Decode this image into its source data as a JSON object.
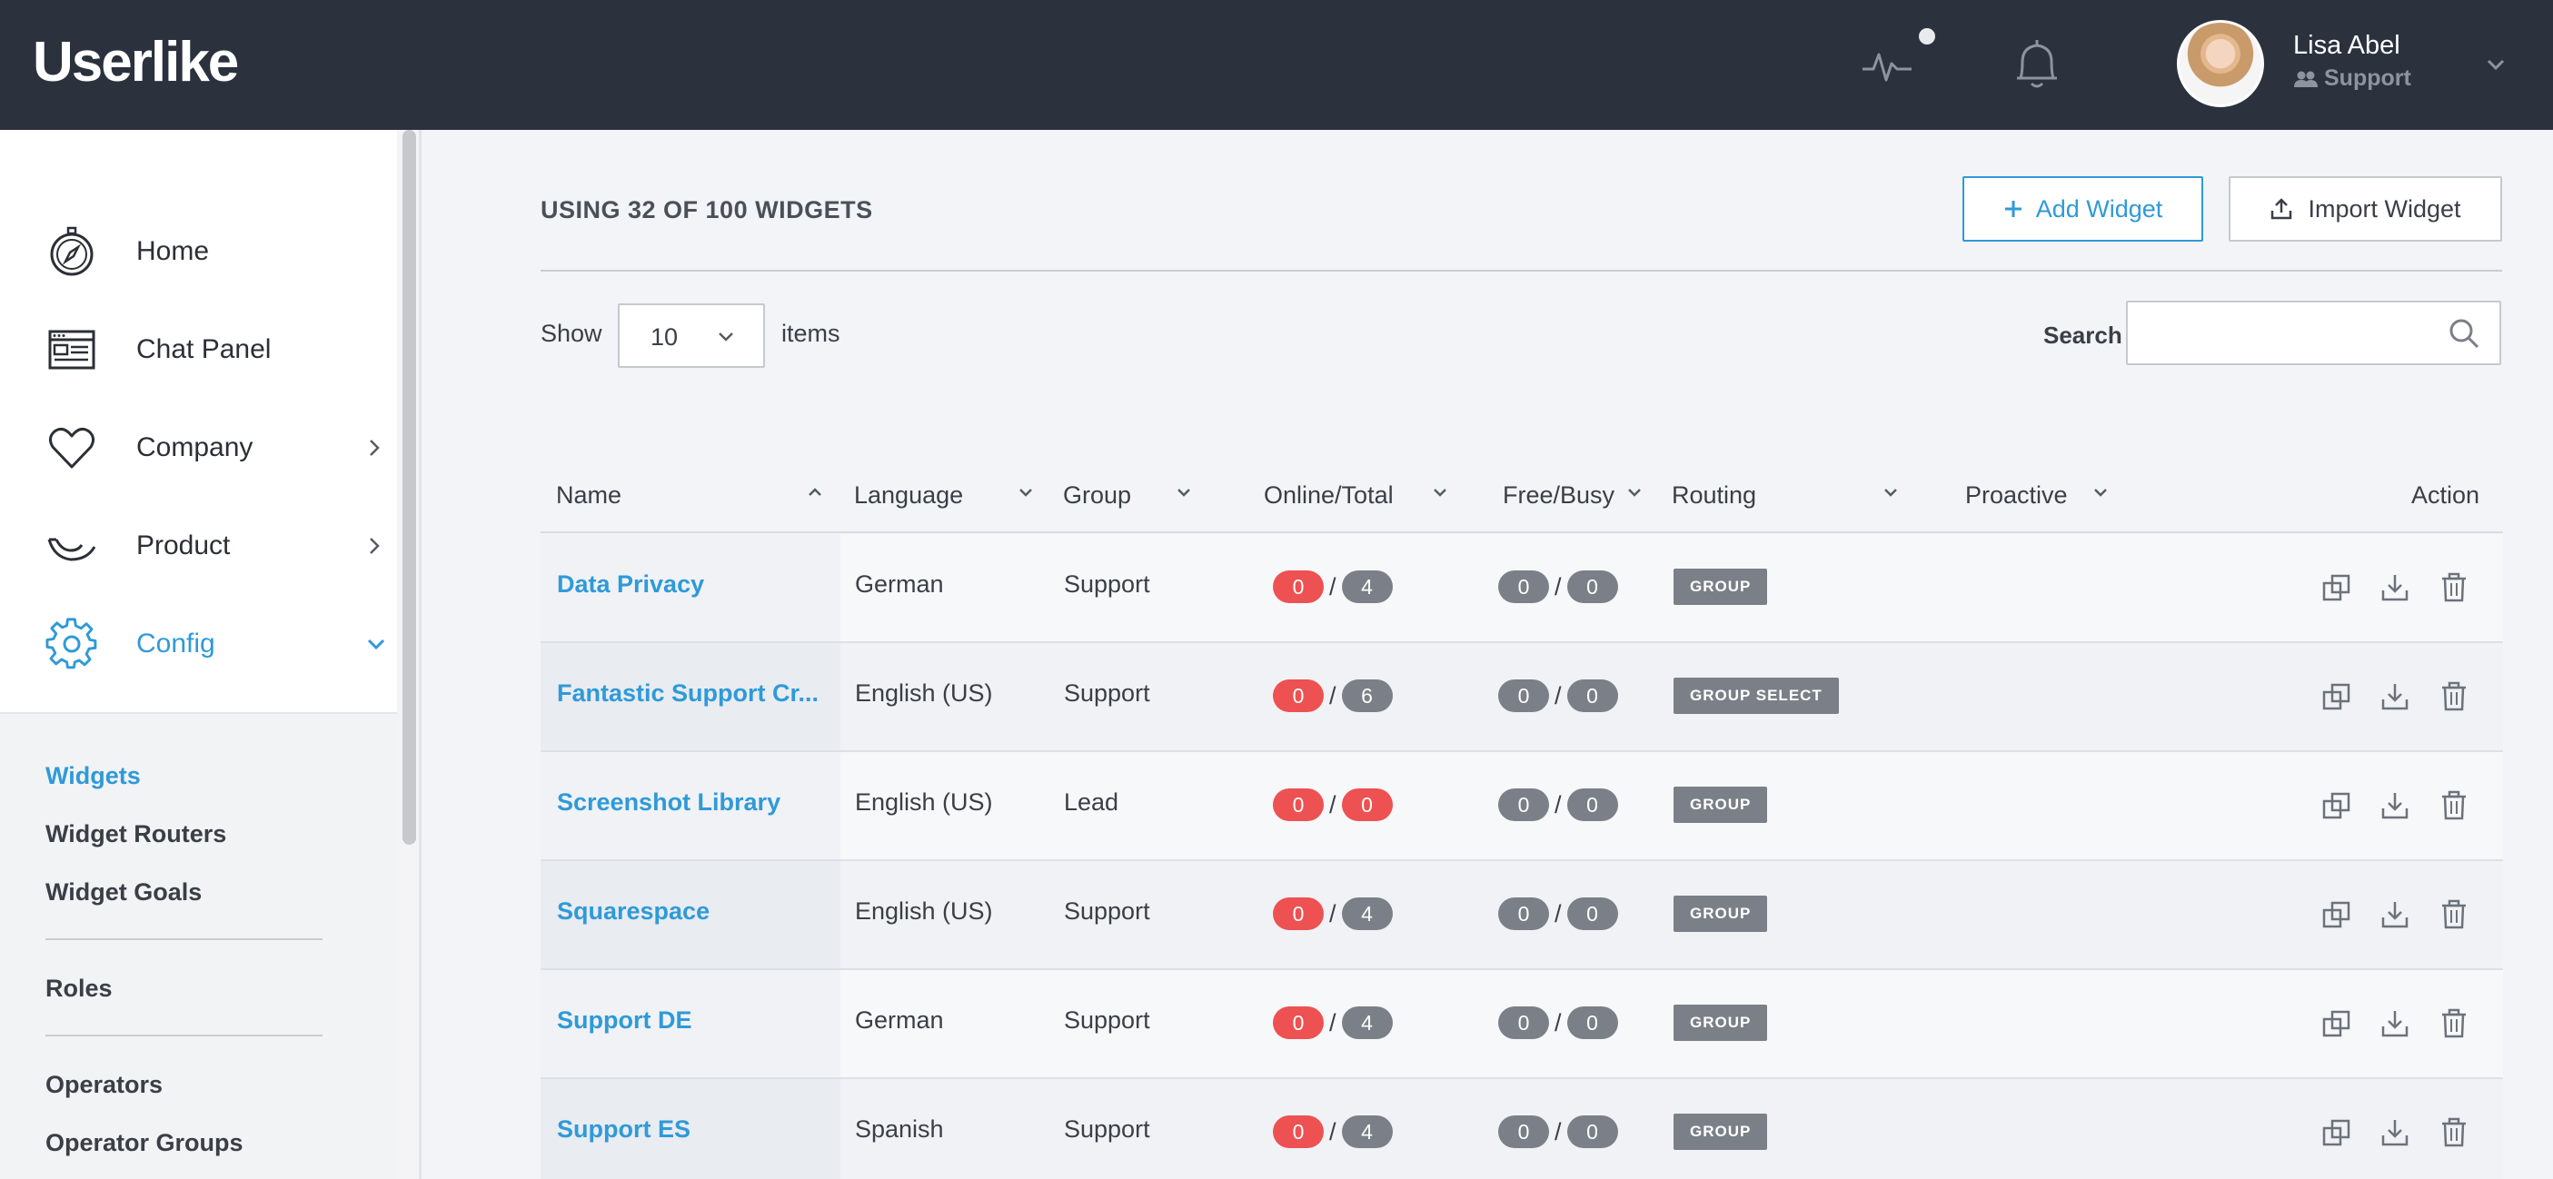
{
  "header": {
    "logo": "Userlike",
    "user": {
      "name": "Lisa Abel",
      "role": "Support"
    }
  },
  "sidebar": {
    "items": [
      {
        "label": "Home",
        "icon": "compass-icon"
      },
      {
        "label": "Chat Panel",
        "icon": "chat-panel-icon"
      },
      {
        "label": "Company",
        "icon": "heart-icon"
      },
      {
        "label": "Product",
        "icon": "product-icon"
      },
      {
        "label": "Config",
        "icon": "gear-icon"
      }
    ],
    "sub_items": {
      "widgets": "Widgets",
      "widget_routers": "Widget Routers",
      "widget_goals": "Widget Goals",
      "roles": "Roles",
      "operators": "Operators",
      "operator_groups": "Operator Groups"
    }
  },
  "main": {
    "usage_title": "USING 32 OF 100 WIDGETS",
    "add_button": "Add Widget",
    "import_button": "Import Widget",
    "show_label": "Show",
    "show_value": "10",
    "items_label": "items",
    "search_label": "Search",
    "search_value": ""
  },
  "table": {
    "headers": {
      "name": "Name",
      "language": "Language",
      "group": "Group",
      "online_total": "Online/Total",
      "free_busy": "Free/Busy",
      "routing": "Routing",
      "proactive": "Proactive",
      "action": "Action"
    },
    "rows": [
      {
        "name": "Data Privacy",
        "language": "German",
        "group": "Support",
        "online": "0",
        "total": "4",
        "free": "0",
        "busy": "0",
        "routing": "GROUP",
        "proactive": ""
      },
      {
        "name": "Fantastic Support Cr...",
        "language": "English (US)",
        "group": "Support",
        "online": "0",
        "total": "6",
        "free": "0",
        "busy": "0",
        "routing": "GROUP SELECT",
        "proactive": ""
      },
      {
        "name": "Screenshot Library",
        "language": "English (US)",
        "group": "Lead",
        "online": "0",
        "total": "0",
        "free": "0",
        "busy": "0",
        "routing": "GROUP",
        "proactive": ""
      },
      {
        "name": "Squarespace",
        "language": "English (US)",
        "group": "Support",
        "online": "0",
        "total": "4",
        "free": "0",
        "busy": "0",
        "routing": "GROUP",
        "proactive": ""
      },
      {
        "name": "Support DE",
        "language": "German",
        "group": "Support",
        "online": "0",
        "total": "4",
        "free": "0",
        "busy": "0",
        "routing": "GROUP",
        "proactive": ""
      },
      {
        "name": "Support ES",
        "language": "Spanish",
        "group": "Support",
        "online": "0",
        "total": "4",
        "free": "0",
        "busy": "0",
        "routing": "GROUP",
        "proactive": ""
      }
    ]
  },
  "colors": {
    "accent": "#2f9ad8",
    "topbar": "#2b323d",
    "pill_red": "#ee5151",
    "pill_grey": "#7b8088"
  }
}
